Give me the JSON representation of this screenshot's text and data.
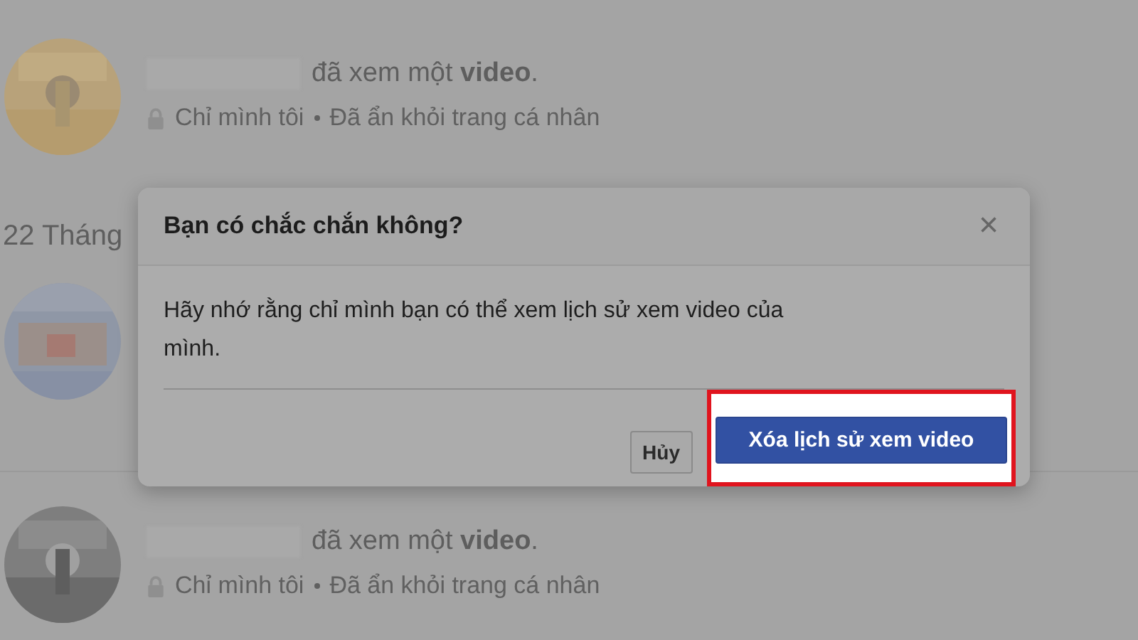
{
  "feed": [
    {
      "kind": "entry",
      "action": "đã xem một **video**.",
      "privacy": "Chỉ mình tôi",
      "status": "Đã ẩn khỏi trang cá nhân"
    },
    {
      "kind": "date",
      "label": "22 Tháng"
    },
    {
      "kind": "covered"
    },
    {
      "kind": "entry",
      "action": "đã xem một **video**.",
      "privacy": "Chỉ mình tôi",
      "status": "Đã ẩn khỏi trang cá nhân"
    }
  ],
  "dialog": {
    "title": "Bạn có chắc chắn không?",
    "close": "×",
    "message": "Hãy nhớ rằng chỉ mình bạn có thể xem lịch sử xem video của mình.",
    "buttons": [
      {
        "label": "Hủy",
        "kind": "secondary"
      },
      {
        "label": "Xóa lịch sử xem video",
        "kind": "primary",
        "highlighted": true
      }
    ]
  }
}
